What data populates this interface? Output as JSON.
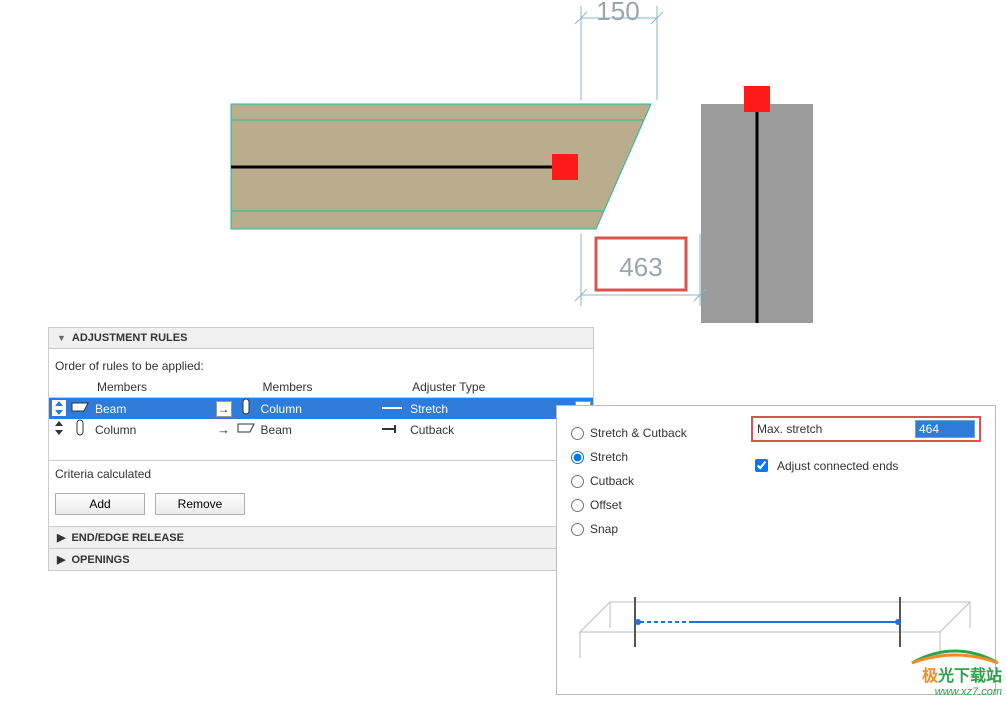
{
  "dimensions": {
    "val_top": "150",
    "val_bottom": "463"
  },
  "panel": {
    "header": "ADJUSTMENT RULES",
    "order_label": "Order of rules to be applied:",
    "columns": {
      "c1": "Members",
      "c2": "Members",
      "c3": "Adjuster Type"
    },
    "rows": [
      {
        "m1": "Beam",
        "m2": "Column",
        "type": "Stretch",
        "selected": true
      },
      {
        "m1": "Column",
        "m2": "Beam",
        "type": "Cutback",
        "selected": false
      }
    ],
    "criteria": "Criteria calculated",
    "add": "Add",
    "remove": "Remove",
    "end_edge": "END/EDGE RELEASE",
    "openings": "OPENINGS"
  },
  "options": {
    "radios": {
      "stretch_cutback": "Stretch & Cutback",
      "stretch": "Stretch",
      "cutback": "Cutback",
      "offset": "Offset",
      "snap": "Snap"
    },
    "selected_radio": "stretch",
    "max_label": "Max. stretch",
    "max_value": "464",
    "adjust_label": "Adjust connected ends",
    "adjust_checked": true
  },
  "watermark": {
    "text": "极光下载站",
    "url": "www.xz7.com"
  }
}
